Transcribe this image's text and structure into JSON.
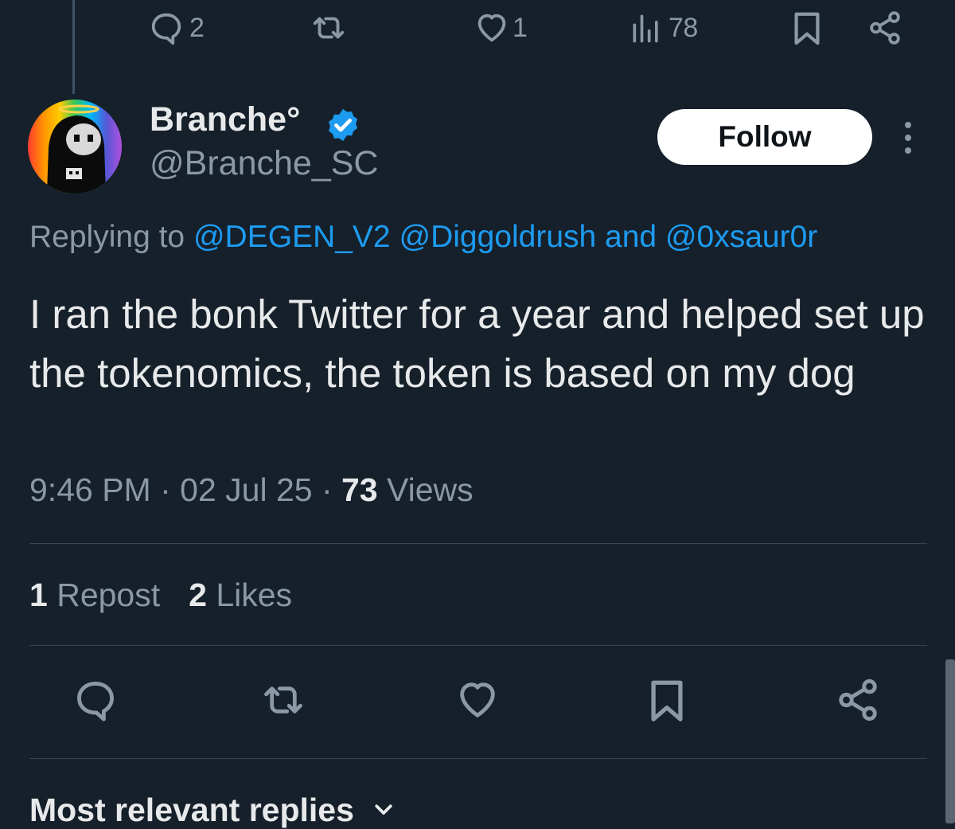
{
  "prev_tweet_actions": {
    "reply_count": "2",
    "repost_count": "",
    "like_count": "1",
    "view_count": "78"
  },
  "author": {
    "display_name": "Branche°",
    "handle": "@Branche_SC",
    "verified": true
  },
  "follow_label": "Follow",
  "replying": {
    "prefix": "Replying to ",
    "mention1": "@DEGEN_V2",
    "mention2": "@Diggoldrush",
    "conj": " and ",
    "mention3": "@0xsaur0r"
  },
  "tweet": {
    "text": "I ran the bonk Twitter for a year and helped set up the tokenomics, the token is based on my dog"
  },
  "meta": {
    "time": "9:46 PM",
    "sep1": " · ",
    "date": "02 Jul 25",
    "sep2": " · ",
    "views": "73",
    "views_label": " Views"
  },
  "stats": {
    "reposts": "1",
    "reposts_label": " Repost",
    "likes": "2",
    "likes_label": " Likes"
  },
  "replies_sort_label": "Most relevant replies",
  "colors": {
    "background": "#15202b",
    "accent": "#1d9bf0",
    "muted": "#8b98a5",
    "text": "#e7e9ea"
  },
  "icons": {
    "reply": "reply-icon",
    "repost": "repost-icon",
    "like": "heart-icon",
    "views": "bar-chart-icon",
    "bookmark": "bookmark-icon",
    "share": "share-icon",
    "verified": "verified-badge-icon",
    "more": "more-vertical-icon",
    "sort": "chevron-down-icon"
  }
}
